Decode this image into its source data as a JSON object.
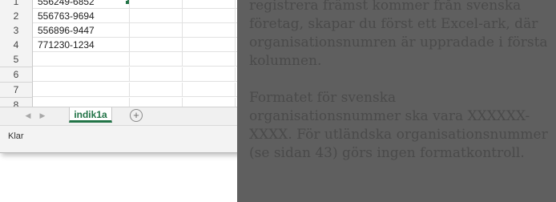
{
  "rows": [
    {
      "num": "1",
      "value": "556249-6852"
    },
    {
      "num": "2",
      "value": "556763-9694"
    },
    {
      "num": "3",
      "value": "556896-9447"
    },
    {
      "num": "4",
      "value": "771230-1234"
    },
    {
      "num": "5",
      "value": ""
    },
    {
      "num": "6",
      "value": ""
    },
    {
      "num": "7",
      "value": ""
    },
    {
      "num": "8",
      "value": ""
    }
  ],
  "sheet_tab": "indik1a",
  "status_text": "Klar",
  "icons": {
    "nav_prev": "chevron-left-icon",
    "nav_next": "chevron-right-icon",
    "add_sheet": "plus-circle-icon"
  },
  "colors": {
    "accent": "#217346",
    "overlay": "#5f5f5f",
    "overlay_text": "#4a4a4a"
  },
  "document": {
    "paragraph1": "registrera främst kommer från svenska företag, skapar du först ett Excel-ark, där organisationsnumren är uppradade i första kolumnen.",
    "paragraph2": "Formatet för svenska organisationsnummer ska vara XXXXXX-XXXX. För utländska organisationsnummer (se sidan 43) görs ingen formatkontroll."
  }
}
